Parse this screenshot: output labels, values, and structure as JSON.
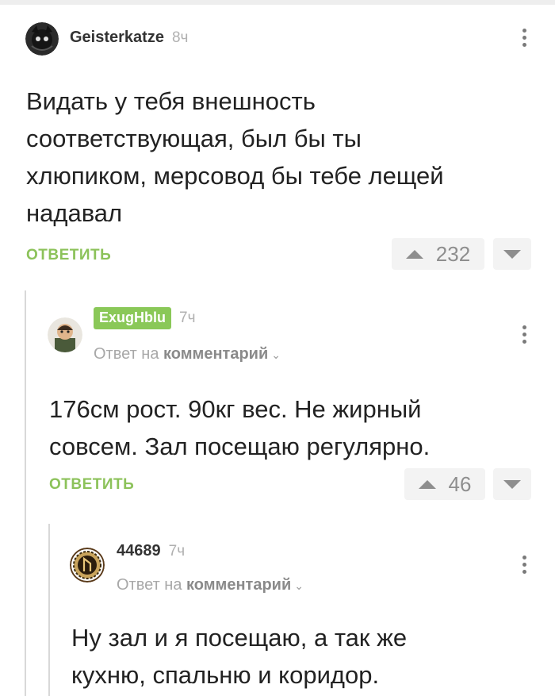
{
  "comments": [
    {
      "username": "Geisterkatze",
      "time": "8ч",
      "text_lines": [
        "Видать у тебя внешность",
        "соответствующая, был бы ты",
        "хлюпиком, мерсовод бы тебе лещей",
        "надавал"
      ],
      "reply_label": "ОТВЕТИТЬ",
      "rating": "232"
    },
    {
      "username": "ExugHblu",
      "time": "7ч",
      "reply_to_prefix": "Ответ на",
      "reply_to_target": "комментарий",
      "text_lines": [
        "176см рост. 90кг вес. Не жирный",
        "совсем. Зал посещаю регулярно."
      ],
      "reply_label": "ОТВЕТИТЬ",
      "rating": "46"
    },
    {
      "username": "44689",
      "time": "7ч",
      "reply_to_prefix": "Ответ на",
      "reply_to_target": "комментарий",
      "text_lines": [
        "Ну зал и я посещаю, а так же",
        "кухню, спальню и коридор."
      ]
    }
  ],
  "icons": {
    "upvote": "triangle-up-icon",
    "downvote": "triangle-down-icon",
    "menu": "kebab-icon",
    "expand": "chevron-down-icon"
  },
  "colors": {
    "accent_green": "#8cc25a",
    "badge_green": "#8ac858",
    "muted_gray": "#a8a8a8"
  }
}
